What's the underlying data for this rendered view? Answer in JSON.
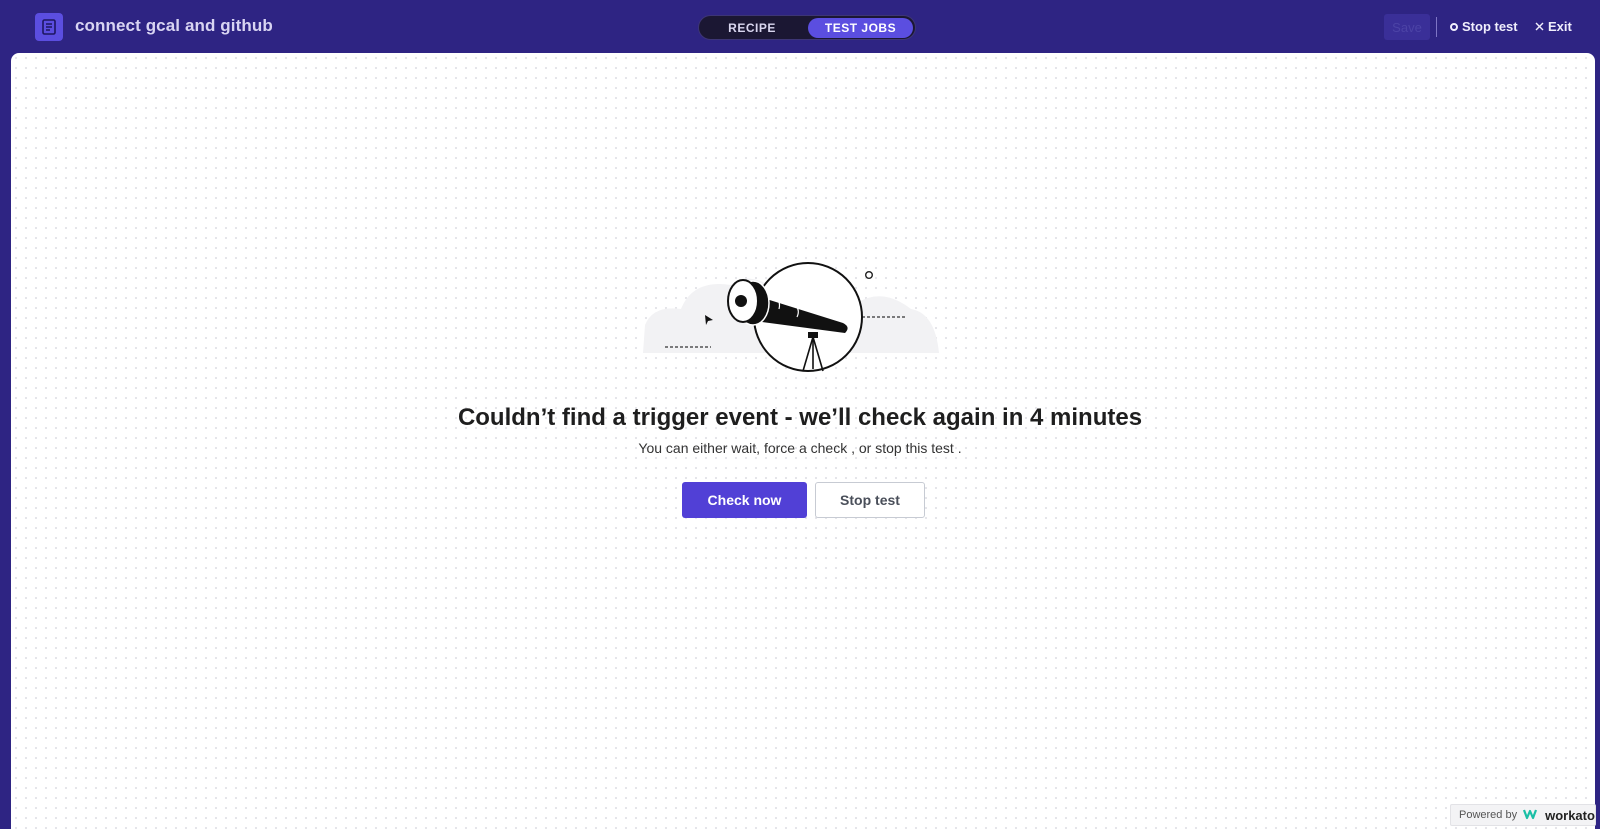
{
  "header": {
    "title": "connect gcal and github",
    "tabs": [
      {
        "label": "RECIPE",
        "active": false
      },
      {
        "label": "TEST JOBS",
        "active": true
      }
    ],
    "save_label": "Save",
    "stop_label": "Stop test",
    "exit_label": "Exit"
  },
  "main": {
    "headline": "Couldn’t find a trigger event - we’ll check again in 4 minutes",
    "subline": "You can either wait, force a check , or stop this test .",
    "check_now_label": "Check now",
    "stop_test_label": "Stop test"
  },
  "footer": {
    "powered_by": "Powered by",
    "brand": "workato"
  },
  "icons": {
    "app": "recipe-doc-icon",
    "stop": "stop-ring-icon",
    "exit": "close-icon",
    "illustration": "telescope-illustration",
    "brand_logo": "workato-logo-icon"
  },
  "colors": {
    "header_bg": "#2e2483",
    "accent": "#5140d6",
    "toggle_active": "#5b4ee0"
  }
}
